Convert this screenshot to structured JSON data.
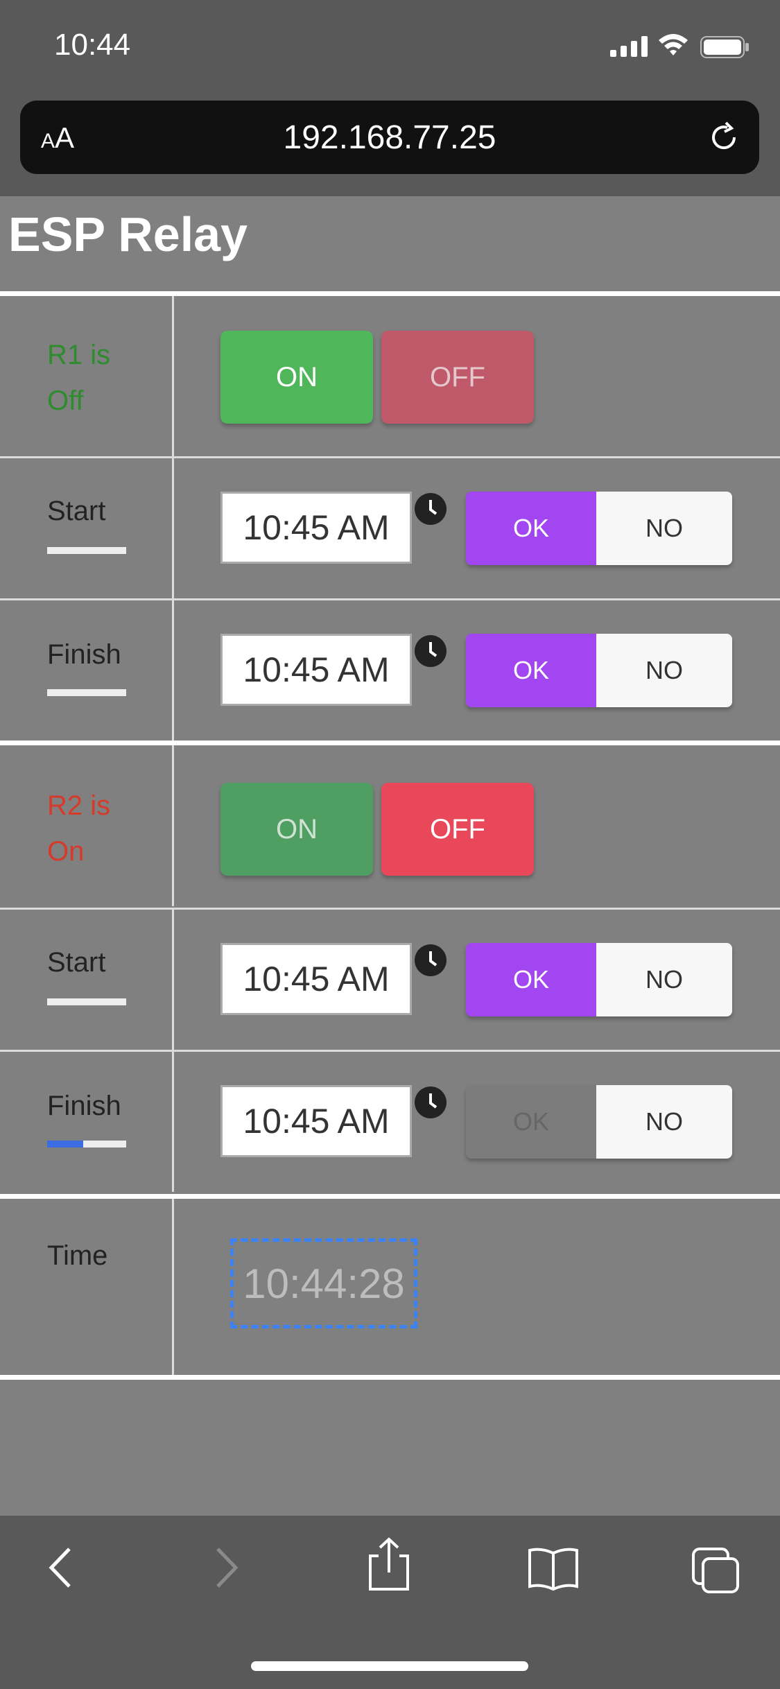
{
  "status": {
    "time": "10:44"
  },
  "browser": {
    "text_size_small": "A",
    "text_size_large": "A",
    "url": "192.168.77.25"
  },
  "page": {
    "title": "ESP Relay"
  },
  "relays": [
    {
      "state_line1": "R1 is",
      "state_line2": "Off",
      "on_label": "ON",
      "off_label": "OFF",
      "schedule": [
        {
          "label": "Start",
          "time": "10:45 AM",
          "ok_label": "OK",
          "no_label": "NO"
        },
        {
          "label": "Finish",
          "time": "10:45 AM",
          "ok_label": "OK",
          "no_label": "NO"
        }
      ]
    },
    {
      "state_line1": "R2 is",
      "state_line2": "On",
      "on_label": "ON",
      "off_label": "OFF",
      "schedule": [
        {
          "label": "Start",
          "time": "10:45 AM",
          "ok_label": "OK",
          "no_label": "NO"
        },
        {
          "label": "Finish",
          "time": "10:45 AM",
          "ok_label": "OK",
          "no_label": "NO"
        }
      ]
    }
  ],
  "clock": {
    "label": "Time",
    "value": "10:44:28"
  },
  "colors": {
    "on_green": "#4fb65a",
    "off_red": "#e8485a",
    "ok_purple": "#a146f0",
    "state_off_green": "#2e8b2e",
    "state_on_red": "#d63a2a"
  },
  "icons": {
    "status": [
      "signal-icon",
      "wifi-icon",
      "battery-icon"
    ],
    "toolbar": [
      "back-icon",
      "forward-icon",
      "share-icon",
      "bookmarks-icon",
      "tabs-icon"
    ]
  }
}
